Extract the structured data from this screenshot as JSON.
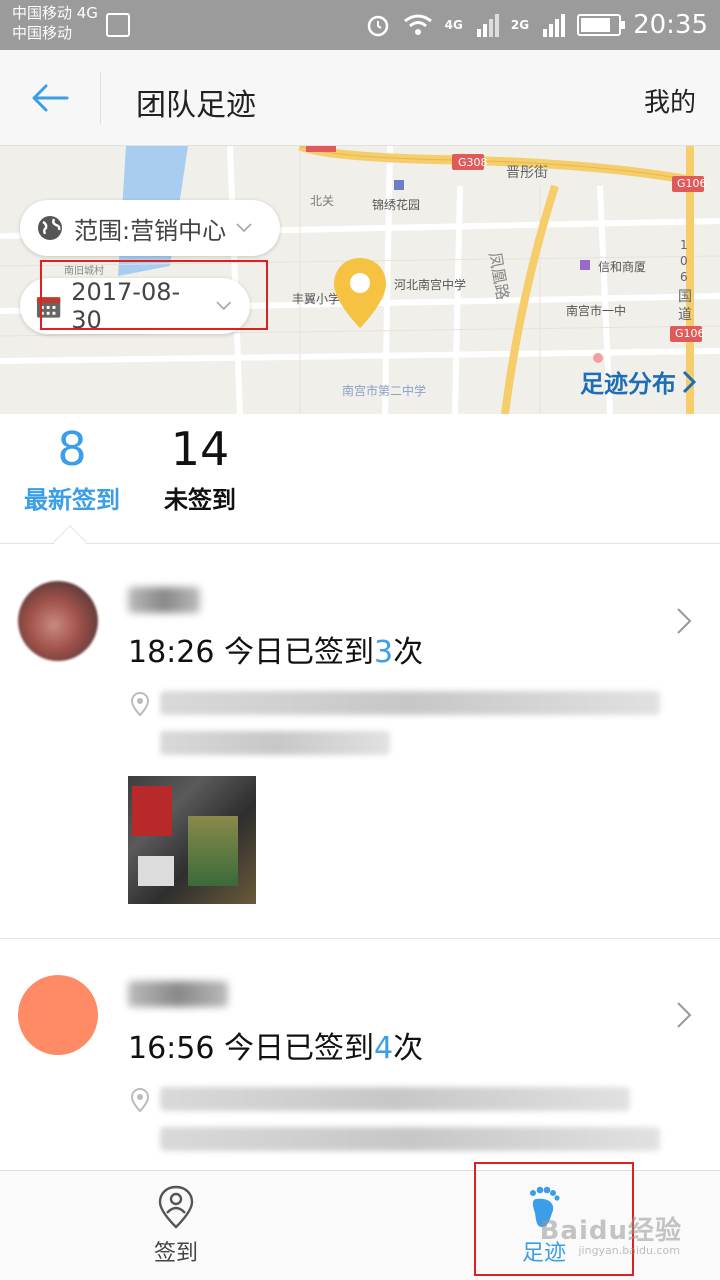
{
  "status_bar": {
    "carrier_line1": "中国移动 4G",
    "carrier_line2": "中国移动",
    "net1": "4G",
    "net2": "2G",
    "time": "20:35",
    "battery_level": 0.8,
    "icons": [
      "image-icon",
      "alarm-icon",
      "wifi-icon",
      "signal-icon",
      "battery-icon"
    ]
  },
  "header": {
    "title": "团队足迹",
    "mine": "我的",
    "back_icon": "arrow-left-icon"
  },
  "map": {
    "labels": [
      "G308",
      "晋彤街",
      "G106",
      "北关",
      "锦绣花园",
      "信和商厦",
      "南旧城村",
      "河北南宫中学",
      "丰翼小学",
      "南宫市一中",
      "南宫市第二中学",
      "凤凰路",
      "1",
      "0",
      "6",
      "国",
      "道",
      "G106"
    ],
    "range_label": "范围:营销中心",
    "date_label": "2017-08-30",
    "distribution_link": "足迹分布"
  },
  "stats": {
    "latest_count": "8",
    "latest_label": "最新签到",
    "unsigned_count": "14",
    "unsigned_label": "未签到"
  },
  "records": [
    {
      "time": "18:26",
      "text": "今日已签到",
      "count": "3",
      "unit": "次",
      "has_thumbnail": true
    },
    {
      "time": "16:56",
      "text": "今日已签到",
      "count": "4",
      "unit": "次",
      "has_thumbnail": false
    }
  ],
  "bottom_nav": [
    {
      "label": "签到",
      "icon": "location-person-icon",
      "active": false
    },
    {
      "label": "足迹",
      "icon": "footprint-icon",
      "active": true
    }
  ],
  "watermark": {
    "text": "Baidu经验",
    "url": "jingyan.baidu.com"
  },
  "colors": {
    "accent": "#3a9ee8",
    "link": "#1d6fb5",
    "avatar2": "#ff8a66",
    "pin": "#f5c242",
    "highlight": "#e02020"
  }
}
